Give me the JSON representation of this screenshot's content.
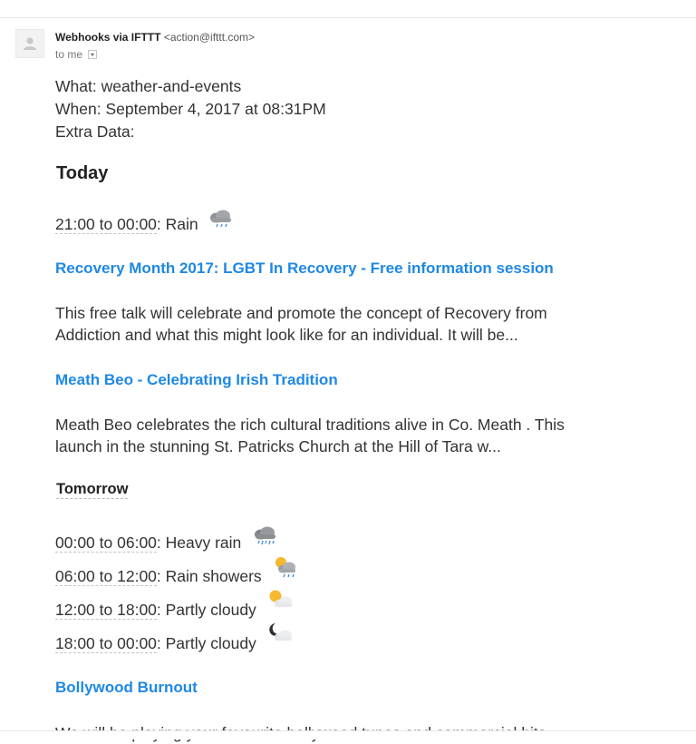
{
  "email": {
    "sender_name": "Webhooks via IFTTT",
    "sender_email": "<action@ifttt.com>",
    "to_label": "to me"
  },
  "body": {
    "what_line": "What: weather-and-events",
    "when_line": "When: September 4, 2017 at 08:31PM",
    "extra_line": "Extra Data:"
  },
  "today": {
    "heading": "Today",
    "forecast": [
      {
        "time": "21:00 to 00:00",
        "condition": ": Rain",
        "icon": "rain-cloud-icon"
      }
    ],
    "events": [
      {
        "title": "Recovery Month 2017: LGBT In Recovery - Free information session",
        "description_line1": "This free talk will celebrate and promote the concept of Recovery from",
        "description_line2": "Addiction and what this might look like for an individual. It will be..."
      },
      {
        "title": "Meath Beo - Celebrating Irish Tradition",
        "description_line1": "Meath Beo celebrates the rich cultural traditions alive in Co. Meath . This",
        "description_line2": "launch in the stunning St. Patricks Church at the Hill of Tara w..."
      }
    ]
  },
  "tomorrow": {
    "heading": "Tomorrow",
    "forecast": [
      {
        "time": "00:00 to 06:00",
        "condition": ": Heavy rain",
        "icon": "heavy-rain-cloud-icon"
      },
      {
        "time": "06:00 to 12:00",
        "condition": ": Rain showers",
        "icon": "sun-rain-showers-icon"
      },
      {
        "time": "12:00 to 18:00",
        "condition": ": Partly cloudy",
        "icon": "sun-partly-cloudy-icon"
      },
      {
        "time": "18:00 to 00:00",
        "condition": ": Partly cloudy",
        "icon": "moon-partly-cloudy-icon"
      }
    ],
    "events": [
      {
        "title": "Bollywood Burnout",
        "description_line1": "We will be playing your favourite bollywood tunes and commercial hits..."
      }
    ]
  },
  "colors": {
    "link": "#1e88e5",
    "text": "#333333"
  }
}
